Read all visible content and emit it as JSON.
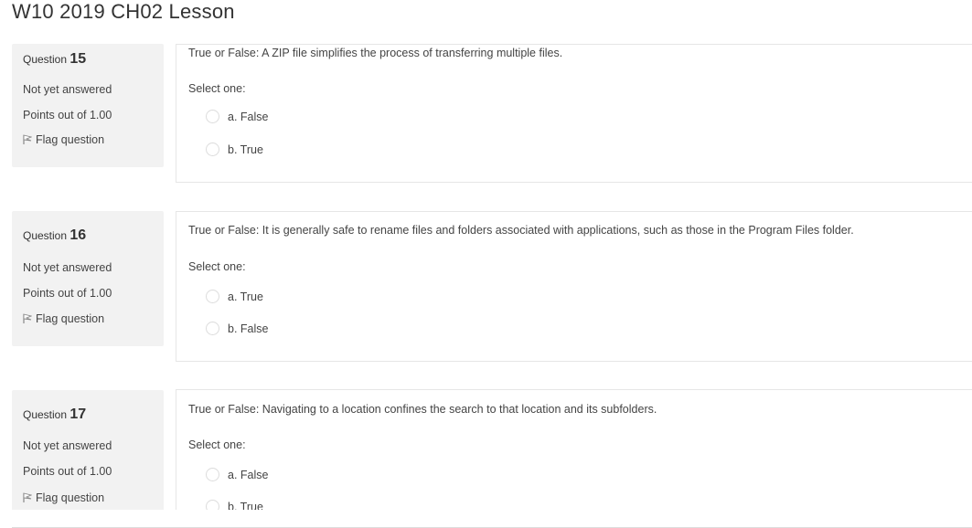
{
  "page": {
    "title": "W10 2019 CH02 Lesson"
  },
  "questions": [
    {
      "label": "Question",
      "number": "15",
      "state": "Not yet answered",
      "points": "Points out of 1.00",
      "flag_label": "Flag question",
      "text": "True or False: A ZIP file simplifies the process of transferring multiple files.",
      "prompt": "Select one:",
      "options": [
        "a. False",
        "b. True"
      ]
    },
    {
      "label": "Question",
      "number": "16",
      "state": "Not yet answered",
      "points": "Points out of 1.00",
      "flag_label": "Flag question",
      "text": "True or False: It is generally safe to rename files and folders associated with applications, such as those in the Program Files folder.",
      "prompt": "Select one:",
      "options": [
        "a. True",
        "b. False"
      ]
    },
    {
      "label": "Question",
      "number": "17",
      "state": "Not yet answered",
      "points": "Points out of 1.00",
      "flag_label": "Flag question",
      "text": "True or False: Navigating to a location confines the search to that location and its subfolders.",
      "prompt": "Select one:",
      "options": [
        "a. False",
        "b. True"
      ]
    }
  ],
  "icons": {
    "flag": "flag-icon",
    "radio": "radio-button-unchecked"
  }
}
